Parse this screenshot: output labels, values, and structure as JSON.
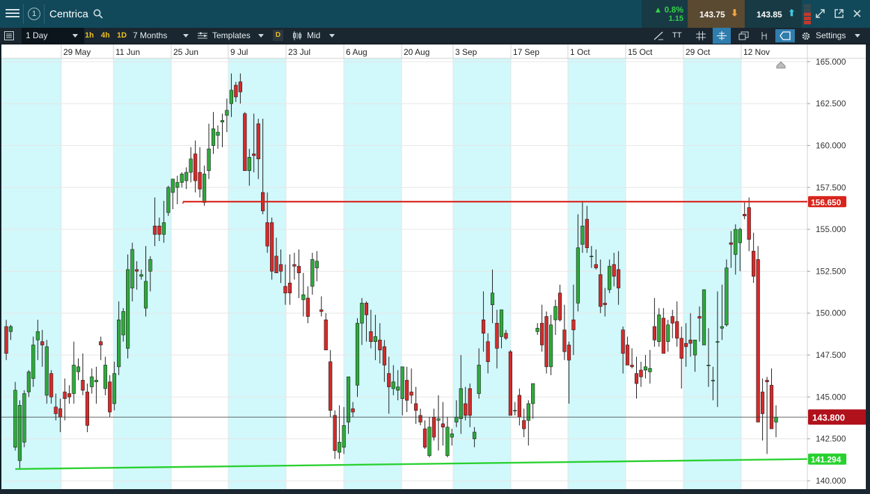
{
  "header": {
    "instrument": "Centrica",
    "notification_count": "1",
    "change_pct": "▲ 0.8%",
    "change_abs": "1.15",
    "sell_price": "143.75",
    "buy_price": "143.85"
  },
  "toolbar": {
    "interval": "1 Day",
    "quick_intervals": [
      "1h",
      "4h",
      "1D"
    ],
    "range": "7 Months",
    "templates": "Templates",
    "price_type_badge": "D",
    "price_type": "Mid",
    "text_tool": "TT",
    "settings": "Settings"
  },
  "colors": {
    "up": "#2eaa3b",
    "down": "#d62a2a",
    "band": "#d1f8fb",
    "resistance": "#d9241c",
    "support": "#27d12e"
  },
  "chart_data": {
    "type": "candlestick",
    "x_ticks": [
      "29 May",
      "11 Jun",
      "25 Jun",
      "9 Jul",
      "23 Jul",
      "6 Aug",
      "20 Aug",
      "3 Sep",
      "17 Sep",
      "1 Oct",
      "15 Oct",
      "29 Oct",
      "12 Nov"
    ],
    "y_ticks": [
      "165.000",
      "162.500",
      "160.000",
      "157.500",
      "155.000",
      "152.500",
      "150.000",
      "147.500",
      "145.000",
      "142.500",
      "140.000"
    ],
    "ylim": [
      139.5,
      165.2
    ],
    "grid": true,
    "resistance_label": "156.650",
    "resistance_value": 156.65,
    "support_label": "141.294",
    "support_start": 140.7,
    "support_end": 141.294,
    "last_label": "143.800",
    "last_value": 143.8,
    "candles": [
      [
        149.2,
        149.6,
        147.2,
        147.6
      ],
      [
        148.9,
        149.3,
        148.4,
        149.2
      ],
      [
        142.0,
        145.9,
        141.8,
        145.4
      ],
      [
        141.2,
        144.8,
        140.7,
        144.5
      ],
      [
        142.3,
        145.4,
        142.0,
        145.2
      ],
      [
        145.3,
        146.6,
        145.0,
        146.5
      ],
      [
        146.1,
        148.6,
        145.6,
        148.1
      ],
      [
        148.4,
        149.6,
        147.2,
        148.9
      ],
      [
        148.3,
        149.0,
        146.8,
        148.1
      ],
      [
        145.1,
        148.4,
        144.6,
        148.0
      ],
      [
        146.4,
        146.6,
        144.6,
        145.0
      ],
      [
        144.4,
        145.2,
        143.6,
        144.0
      ],
      [
        144.3,
        144.9,
        142.9,
        143.8
      ],
      [
        145.3,
        146.1,
        143.6,
        144.9
      ],
      [
        145.2,
        145.7,
        144.6,
        145.0
      ],
      [
        145.2,
        148.3,
        144.6,
        146.9
      ],
      [
        146.5,
        147.3,
        146.0,
        146.8
      ],
      [
        146.0,
        147.6,
        145.1,
        145.4
      ],
      [
        145.3,
        145.8,
        142.9,
        143.3
      ],
      [
        145.6,
        146.7,
        145.2,
        146.2
      ],
      [
        145.9,
        146.8,
        144.6,
        146.0
      ],
      [
        148.3,
        148.6,
        147.2,
        148.1
      ],
      [
        145.5,
        147.4,
        145.1,
        146.9
      ],
      [
        145.9,
        146.3,
        143.8,
        144.1
      ],
      [
        144.6,
        147.1,
        144.2,
        146.4
      ],
      [
        146.8,
        150.7,
        146.3,
        149.6
      ],
      [
        148.7,
        150.3,
        148.3,
        150.1
      ],
      [
        147.9,
        153.5,
        147.3,
        152.6
      ],
      [
        151.5,
        154.2,
        150.7,
        153.8
      ],
      [
        152.6,
        153.1,
        151.4,
        152.5
      ],
      [
        152.2,
        152.6,
        152.0,
        152.3
      ],
      [
        150.3,
        154.0,
        149.8,
        151.9
      ],
      [
        152.5,
        153.4,
        151.3,
        153.2
      ],
      [
        155.2,
        156.9,
        154.0,
        154.7
      ],
      [
        155.2,
        155.7,
        154.3,
        154.7
      ],
      [
        154.7,
        156.7,
        154.2,
        155.4
      ],
      [
        156.0,
        157.6,
        155.8,
        157.5
      ],
      [
        157.2,
        157.9,
        156.2,
        158.0
      ],
      [
        157.5,
        158.2,
        156.5,
        157.8
      ],
      [
        157.8,
        158.4,
        157.5,
        158.3
      ],
      [
        157.9,
        158.7,
        157.4,
        158.4
      ],
      [
        158.4,
        159.9,
        157.8,
        159.2
      ],
      [
        159.5,
        160.3,
        157.2,
        157.9
      ],
      [
        158.4,
        159.9,
        156.9,
        157.4
      ],
      [
        156.6,
        158.8,
        156.4,
        158.3
      ],
      [
        158.5,
        161.3,
        158.0,
        159.8
      ],
      [
        160.0,
        162.0,
        159.5,
        161.0
      ],
      [
        160.6,
        161.2,
        159.8,
        160.8
      ],
      [
        161.4,
        161.9,
        159.9,
        161.5
      ],
      [
        161.8,
        162.8,
        160.8,
        162.1
      ],
      [
        162.5,
        164.3,
        161.7,
        163.3
      ],
      [
        163.6,
        163.8,
        162.6,
        162.9
      ],
      [
        163.8,
        164.3,
        162.5,
        163.2
      ],
      [
        161.9,
        162.0,
        158.6,
        158.5
      ],
      [
        158.5,
        159.8,
        157.6,
        159.3
      ],
      [
        159.5,
        161.9,
        158.4,
        159.4
      ],
      [
        161.3,
        161.6,
        158.0,
        159.2
      ],
      [
        157.2,
        161.6,
        155.9,
        156.1
      ],
      [
        155.4,
        157.2,
        153.6,
        154.0
      ],
      [
        155.4,
        155.7,
        152.0,
        152.5
      ],
      [
        153.4,
        154.5,
        152.6,
        152.4
      ],
      [
        152.9,
        153.8,
        151.8,
        152.5
      ],
      [
        151.6,
        152.9,
        150.5,
        151.2
      ],
      [
        151.8,
        153.5,
        150.5,
        151.2
      ],
      [
        152.9,
        153.6,
        152.0,
        152.8
      ],
      [
        152.8,
        153.8,
        150.9,
        152.4
      ],
      [
        150.8,
        152.4,
        149.8,
        151.1
      ],
      [
        150.9,
        151.6,
        149.4,
        149.8
      ],
      [
        151.6,
        153.6,
        151.1,
        153.2
      ],
      [
        152.7,
        153.7,
        151.9,
        153.1
      ],
      [
        150.2,
        151.0,
        149.8,
        150.1
      ],
      [
        149.6,
        150.0,
        147.9,
        147.8
      ],
      [
        147.1,
        147.8,
        143.8,
        144.2
      ],
      [
        143.9,
        144.2,
        141.3,
        141.8
      ],
      [
        141.7,
        144.5,
        141.3,
        142.3
      ],
      [
        142.0,
        144.4,
        141.6,
        143.3
      ],
      [
        143.5,
        146.0,
        142.8,
        146.2
      ],
      [
        144.3,
        144.7,
        143.8,
        144.1
      ],
      [
        145.7,
        149.7,
        145.0,
        149.4
      ],
      [
        149.4,
        150.9,
        148.1,
        150.6
      ],
      [
        150.6,
        150.7,
        148.3,
        149.9
      ],
      [
        148.9,
        150.2,
        147.9,
        148.3
      ],
      [
        148.3,
        149.9,
        147.2,
        148.6
      ],
      [
        148.4,
        149.4,
        147.0,
        147.8
      ],
      [
        148.0,
        148.4,
        145.9,
        146.9
      ],
      [
        146.4,
        147.4,
        144.0,
        145.6
      ],
      [
        145.5,
        146.9,
        145.1,
        145.9
      ],
      [
        145.4,
        146.6,
        144.8,
        145.6
      ],
      [
        144.9,
        146.8,
        143.9,
        146.8
      ],
      [
        146.0,
        146.8,
        144.1,
        144.8
      ],
      [
        145.3,
        146.7,
        144.6,
        145.1
      ],
      [
        144.6,
        145.6,
        143.4,
        144.2
      ],
      [
        143.9,
        144.3,
        143.3,
        143.5
      ],
      [
        143.1,
        143.6,
        141.9,
        142.0
      ],
      [
        141.5,
        143.8,
        141.4,
        143.2
      ],
      [
        143.8,
        144.3,
        142.4,
        142.6
      ],
      [
        143.6,
        145.1,
        141.8,
        143.7
      ],
      [
        143.4,
        144.7,
        142.1,
        143.2
      ],
      [
        141.5,
        143.8,
        141.4,
        143.2
      ],
      [
        142.6,
        143.1,
        142.1,
        142.8
      ],
      [
        143.5,
        144.8,
        143.2,
        143.8
      ],
      [
        143.7,
        147.5,
        142.8,
        145.5
      ],
      [
        144.6,
        145.6,
        143.6,
        143.9
      ],
      [
        145.5,
        145.8,
        143.2,
        143.9
      ],
      [
        142.5,
        143.2,
        142.0,
        142.9
      ],
      [
        145.2,
        147.9,
        144.9,
        146.9
      ],
      [
        149.6,
        151.3,
        147.7,
        148.8
      ],
      [
        148.3,
        148.8,
        146.4,
        147.1
      ],
      [
        150.5,
        152.6,
        149.4,
        151.2
      ],
      [
        149.4,
        150.2,
        146.7,
        147.9
      ],
      [
        148.6,
        150.2,
        147.9,
        150.2
      ],
      [
        148.8,
        149.0,
        148.4,
        148.5
      ],
      [
        147.7,
        147.8,
        144.2,
        143.9
      ],
      [
        144.2,
        144.7,
        143.9,
        144.2
      ],
      [
        145.1,
        145.5,
        143.3,
        143.8
      ],
      [
        143.6,
        144.3,
        142.6,
        143.1
      ],
      [
        143.6,
        144.8,
        142.1,
        144.6
      ],
      [
        144.6,
        145.4,
        143.7,
        145.8
      ],
      [
        148.9,
        149.4,
        148.7,
        149.1
      ],
      [
        149.4,
        150.5,
        147.7,
        148.1
      ],
      [
        149.8,
        150.1,
        146.4,
        146.8
      ],
      [
        146.8,
        149.9,
        146.3,
        149.3
      ],
      [
        149.6,
        150.8,
        148.7,
        150.4
      ],
      [
        151.2,
        151.7,
        149.5,
        149.6
      ],
      [
        149.0,
        150.5,
        147.2,
        147.7
      ],
      [
        148.1,
        148.3,
        144.6,
        147.2
      ],
      [
        149.6,
        151.7,
        147.5,
        149.0
      ],
      [
        150.6,
        155.9,
        150.1,
        153.9
      ],
      [
        154.1,
        156.7,
        153.6,
        155.2
      ],
      [
        155.6,
        156.4,
        153.6,
        153.9
      ],
      [
        153.4,
        154.0,
        152.7,
        153.4
      ],
      [
        152.9,
        153.8,
        152.6,
        152.7
      ],
      [
        152.3,
        153.2,
        150.0,
        150.4
      ],
      [
        150.6,
        151.5,
        149.8,
        150.5
      ],
      [
        151.4,
        153.2,
        151.2,
        152.8
      ],
      [
        152.9,
        153.6,
        151.6,
        152.2
      ],
      [
        152.6,
        153.7,
        150.5,
        151.5
      ],
      [
        149.0,
        149.2,
        146.4,
        147.6
      ],
      [
        148.1,
        148.6,
        146.9,
        146.9
      ],
      [
        146.9,
        147.9,
        146.7,
        146.8
      ],
      [
        146.4,
        147.4,
        144.9,
        145.8
      ],
      [
        146.6,
        147.1,
        145.6,
        146.2
      ],
      [
        146.6,
        147.5,
        146.1,
        146.8
      ],
      [
        146.5,
        147.8,
        145.8,
        146.7
      ],
      [
        149.2,
        150.9,
        148.0,
        148.4
      ],
      [
        148.3,
        150.3,
        148.0,
        149.9
      ],
      [
        149.7,
        150.3,
        148.2,
        147.6
      ],
      [
        148.3,
        149.6,
        147.7,
        149.3
      ],
      [
        149.8,
        150.2,
        148.5,
        149.4
      ],
      [
        149.5,
        150.7,
        148.0,
        148.5
      ],
      [
        148.5,
        149.2,
        145.5,
        147.3
      ],
      [
        148.2,
        149.4,
        146.8,
        148.0
      ],
      [
        148.4,
        150.0,
        147.4,
        148.2
      ],
      [
        147.5,
        148.3,
        146.5,
        148.4
      ],
      [
        149.8,
        150.4,
        148.3,
        149.7
      ],
      [
        148.1,
        151.0,
        148.1,
        151.4
      ],
      [
        146.9,
        149.1,
        145.6,
        146.9
      ],
      [
        146.0,
        146.8,
        144.8,
        146.0
      ],
      [
        148.3,
        151.3,
        144.4,
        148.3
      ],
      [
        149.1,
        151.7,
        148.4,
        149.2
      ],
      [
        149.3,
        153.2,
        149.2,
        152.7
      ],
      [
        154.2,
        154.9,
        152.7,
        154.1
      ],
      [
        153.5,
        155.3,
        152.3,
        155.0
      ],
      [
        154.2,
        155.1,
        152.5,
        155.0
      ],
      [
        155.9,
        156.6,
        155.6,
        155.8
      ],
      [
        156.3,
        156.9,
        153.7,
        154.4
      ],
      [
        153.7,
        154.8,
        151.8,
        152.2
      ],
      [
        153.2,
        154.0,
        151.8,
        143.5
      ],
      [
        145.3,
        146.1,
        142.4,
        144.0
      ],
      [
        146.0,
        146.2,
        141.6,
        145.9
      ],
      [
        145.7,
        146.7,
        143.3,
        143.1
      ],
      [
        143.5,
        144.5,
        142.6,
        143.8
      ]
    ]
  }
}
